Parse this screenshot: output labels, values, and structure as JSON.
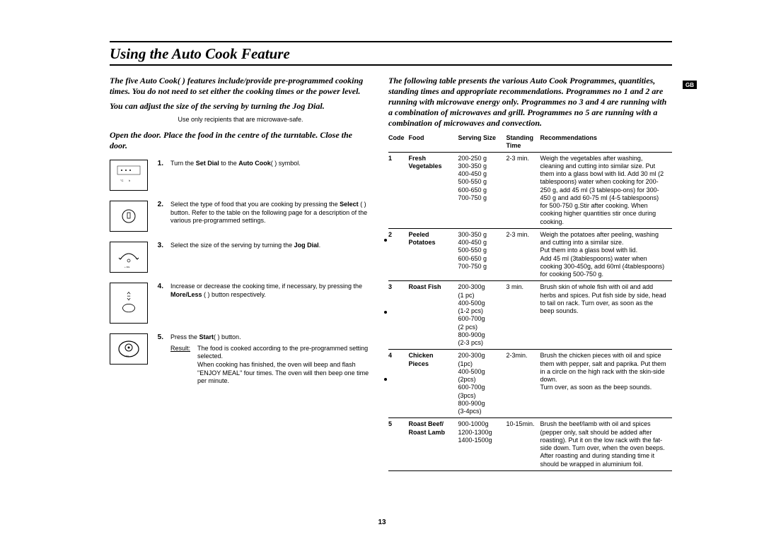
{
  "page_number": "13",
  "gb_label": "GB",
  "title": "Using the Auto Cook Feature",
  "left": {
    "intro1": "The five Auto Cook(       ) features include/provide pre-programmed cooking times. You do not need to set either the cooking times or the power level.",
    "intro2": "You can adjust the size of the serving by turning the Jog Dial.",
    "note": "Use only recipients that are microwave-safe.",
    "intro3": "Open the door. Place the food in the centre of the turntable. Close the door.",
    "steps": [
      {
        "num": "1.",
        "text_before": "Turn the ",
        "bold1": "Set Dial",
        "mid1": " to the ",
        "bold2": "Auto Cook",
        "after": "(       ) symbol."
      },
      {
        "num": "2.",
        "text": "Select the type of food that you are cooking by pressing the ",
        "bold": "Select",
        "paren": " (     ) button. Refer to the table on the following page for a description of the various pre-programmed settings."
      },
      {
        "num": "3.",
        "text": "Select the size of the serving by turning the ",
        "bold": "Jog Dial",
        "after": "."
      },
      {
        "num": "4.",
        "text": "Increase or decrease the cooking time, if necessary, by pressing the ",
        "bold": "More/Less",
        "paren": " (     ) button respectively."
      },
      {
        "num": "5.",
        "text_before": "Press the ",
        "bold": "Start",
        "paren": "(     ) button.",
        "result_label": "Result:",
        "result_text": "The food is cooked according to the pre-programmed setting selected.\nWhen cooking has finished, the oven will beep and flash \"ENJOY MEAL\" four times. The oven will then beep one time per minute."
      }
    ]
  },
  "right": {
    "intro": "The following table presents the various Auto Cook Programmes, quantities, standing times and appropriate recommendations. Programmes no 1 and 2 are running with microwave energy only. Programmes no 3 and 4 are running with a combination of microwaves and grill. Programmes no 5 are running with a combination of microwaves and convection.",
    "headers": {
      "code": "Code",
      "food": "Food",
      "size": "Serving Size",
      "time": "Standing Time",
      "rec": "Recommendations"
    },
    "rows": [
      {
        "code": "1",
        "food": "Fresh Vegetables",
        "size": "200-250 g\n300-350 g\n400-450 g\n500-550 g\n600-650 g\n700-750 g",
        "time": "2-3 min.",
        "rec": "Weigh the vegetables after washing, cleaning and cutting into similar size. Put them into a glass bowl with lid. Add 30 ml (2 tablespoons) water when cooking for 200-250 g, add 45 ml (3 tablespo-ons) for 300-450 g and add 60-75 ml (4-5 tablespoons) for 500-750 g.Stir after cooking. When cooking higher quantities stir once during cooking."
      },
      {
        "code": "2",
        "food": "Peeled Potatoes",
        "size": "300-350 g\n400-450 g\n500-550 g\n600-650 g\n700-750 g",
        "time": "2-3 min.",
        "rec": "Weigh the potatoes after peeling, washing and cutting into a similar size.\nPut them into a glass bowl with lid.\nAdd 45 ml (3tablespoons) water when cooking 300-450g, add 60ml (4tablespoons) for cooking 500-750 g."
      },
      {
        "code": "3",
        "food": "Roast Fish",
        "size": "200-300g\n(1 pc)\n400-500g\n(1-2 pcs)\n600-700g\n(2 pcs)\n800-900g\n(2-3 pcs)",
        "time": "3 min.",
        "rec": "Brush skin of whole fish with oil and add herbs and spices. Put fish side by side, head to tail on rack. Turn over, as soon as the beep sounds."
      },
      {
        "code": "4",
        "food": "Chicken Pieces",
        "size": "200-300g\n(1pc)\n400-500g\n(2pcs)\n600-700g\n(3pcs)\n800-900g\n(3-4pcs)",
        "time": "2-3min.",
        "rec": "Brush the chicken pieces with oil and spice them with pepper, salt and paprika. Put them in a circle on the high rack with the skin-side down.\nTurn over, as soon as the beep sounds."
      },
      {
        "code": "5",
        "food": "Roast Beef/\nRoast Lamb",
        "size": "900-1000g\n1200-1300g\n1400-1500g",
        "time": "10-15min.",
        "rec": "Brush the beef/lamb with oil and spices (pepper only, salt should be added after roasting). Put it on the low rack with the fat-side down. Turn over, when the oven beeps. After roasting and during standing time it should be wrapped in aluminium foil."
      }
    ]
  }
}
